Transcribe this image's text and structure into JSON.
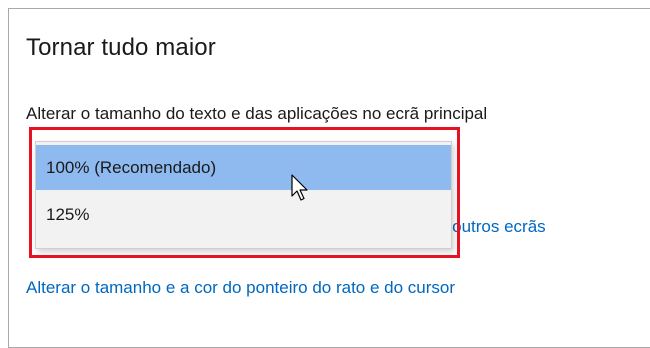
{
  "section": {
    "title": "Tornar tudo maior",
    "description": "Alterar o tamanho do texto e das aplicações no ecrã principal"
  },
  "dropdown": {
    "options": [
      {
        "label": "100% (Recomendado)",
        "selected": true
      },
      {
        "label": "125%",
        "selected": false
      }
    ]
  },
  "links": {
    "other_displays_partial": "es noutros ecrãs",
    "pointer_size": "Alterar o tamanho e a cor do ponteiro do rato e do cursor"
  },
  "colors": {
    "link": "#0067c0",
    "highlight_outline": "#e81123",
    "selected_option": "#8ebaf0"
  },
  "icons": {
    "cursor": "mouse-pointer-icon"
  }
}
